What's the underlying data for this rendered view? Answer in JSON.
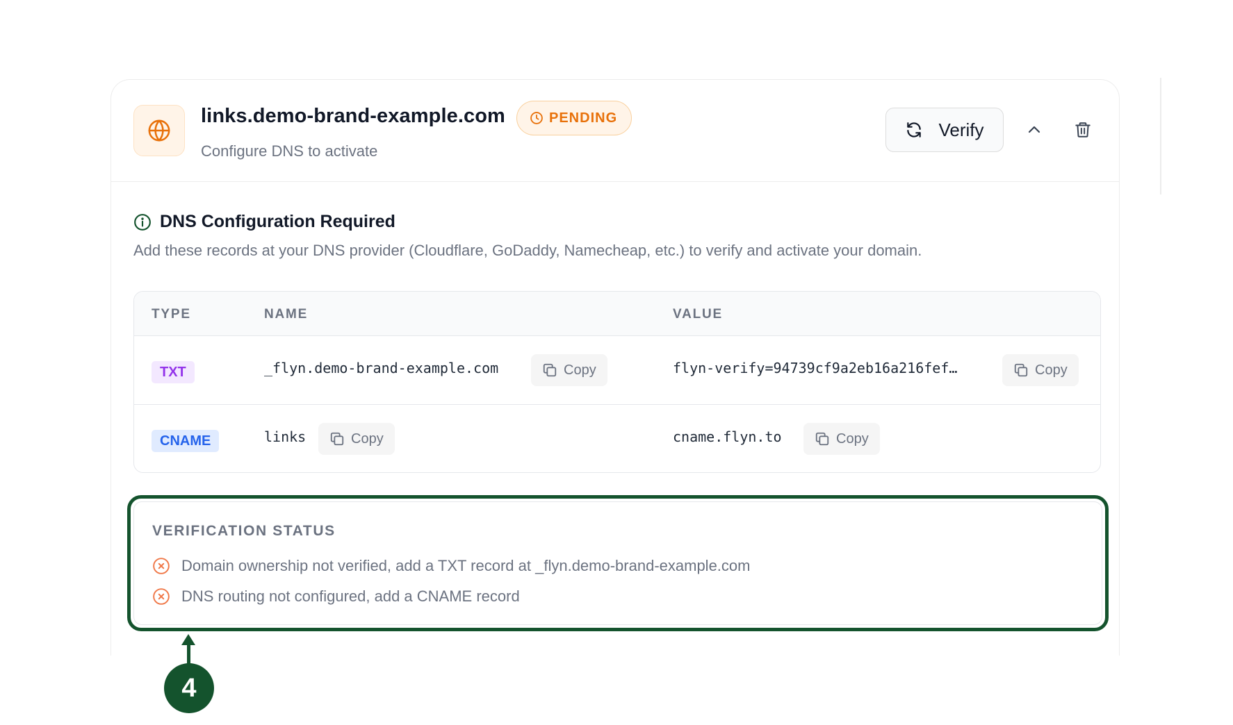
{
  "domain": {
    "name": "links.demo-brand-example.com",
    "status_badge": "PENDING",
    "subtitle": "Configure DNS to activate"
  },
  "actions": {
    "verify_label": "Verify"
  },
  "dns": {
    "heading": "DNS Configuration Required",
    "description": "Add these records at your DNS provider (Cloudflare, GoDaddy, Namecheap, etc.) to verify and activate your domain.",
    "columns": [
      "TYPE",
      "NAME",
      "VALUE"
    ],
    "copy_label": "Copy",
    "records": [
      {
        "type": "TXT",
        "name": "_flyn.demo-brand-example.com",
        "value": "flyn-verify=94739cf9a2eb16a216fef…"
      },
      {
        "type": "CNAME",
        "name": "links",
        "value": "cname.flyn.to"
      }
    ]
  },
  "verification": {
    "title": "VERIFICATION STATUS",
    "items": [
      "Domain ownership not verified, add a TXT record at _flyn.demo-brand-example.com",
      "DNS routing not configured, add a CNAME record"
    ]
  },
  "annotation": {
    "step_number": "4"
  },
  "colors": {
    "pending": "#e8710a",
    "error": "#f07848",
    "annotation": "#14532d",
    "txt_badge": "#9333ea",
    "cname_badge": "#2563eb"
  }
}
